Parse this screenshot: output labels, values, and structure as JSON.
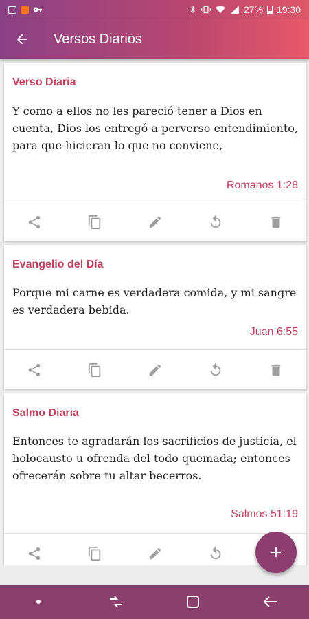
{
  "status_bar": {
    "battery": "27%",
    "time": "19:30"
  },
  "app_bar": {
    "title": "Versos Diarios",
    "back_icon": "arrow-back-icon"
  },
  "cards": [
    {
      "title": "Verso Diaria",
      "text": "Y como a ellos no les pareció tener a Dios en cuenta, Dios los entregó a perverso entendimiento, para que hicieran lo que no conviene,",
      "reference": "Romanos 1:28"
    },
    {
      "title": "Evangelio del Día",
      "text": "Porque mi carne es verdadera comida, y mi sangre es verdadera bebida.",
      "reference": "Juan 6:55"
    },
    {
      "title": "Salmo Diaria",
      "text": "Entonces te agradarán los sacrificios de justicia, el holocausto u ofrenda del todo quemada; entonces ofrecerán sobre tu altar becerros.",
      "reference": "Salmos 51:19"
    }
  ],
  "card_actions": [
    "share-icon",
    "copy-icon",
    "edit-icon",
    "refresh-icon",
    "delete-icon"
  ],
  "fab": {
    "icon": "add-icon"
  },
  "colors": {
    "accent": "#c0415f",
    "app_bar_start": "#8a4285",
    "app_bar_end": "#e8586a",
    "fab": "#8c3f6e",
    "nav_bar": "#8a3f6d"
  }
}
